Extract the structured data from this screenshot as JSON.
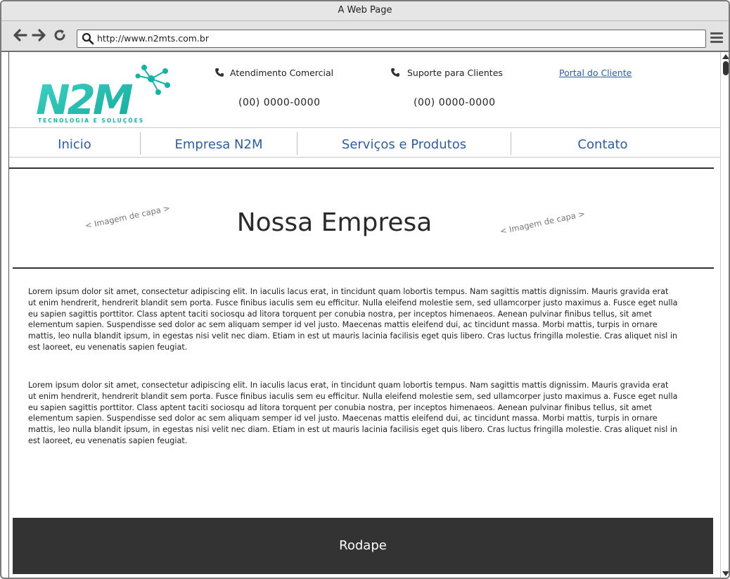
{
  "window": {
    "title": "A Web Page"
  },
  "browser": {
    "url": "http://www.n2mts.com.br"
  },
  "header": {
    "logo_alt": "N2M Tecnologia e Soluções",
    "commercial_label": "Atendimento Comercial",
    "commercial_phone": "(00) 0000-0000",
    "support_label": "Suporte para Clientes",
    "support_phone": "(00) 0000-0000",
    "portal_link": "Portal do Cliente"
  },
  "nav": {
    "items": [
      {
        "label": "Inicio"
      },
      {
        "label": "Empresa N2M"
      },
      {
        "label": "Serviços e Produtos"
      },
      {
        "label": "Contato"
      }
    ]
  },
  "hero": {
    "title": "Nossa Empresa",
    "cover_hint_left": "< Imagem de capa >",
    "cover_hint_right": "< Imagem de capa >"
  },
  "body": {
    "paragraphs": [
      "Lorem ipsum dolor sit amet, consectetur adipiscing elit. In iaculis lacus erat, in tincidunt quam lobortis tempus. Nam sagittis mattis dignissim. Mauris gravida erat ut enim hendrerit, hendrerit blandit sem porta. Fusce finibus iaculis sem eu efficitur. Nulla eleifend molestie sem, sed ullamcorper justo maximus a. Fusce eget nulla eu sapien sagittis porttitor. Class aptent taciti sociosqu ad litora torquent per conubia nostra, per inceptos himenaeos. Aenean pulvinar finibus tellus, sit amet elementum sapien. Suspendisse sed dolor ac sem aliquam semper id vel justo. Maecenas mattis eleifend dui, ac tincidunt massa. Morbi mattis, turpis in ornare mattis, leo nulla blandit ipsum, in egestas nisi velit nec diam. Etiam in est ut mauris lacinia facilisis eget quis libero. Cras luctus fringilla molestie. Cras aliquet nisl in est laoreet, eu venenatis sapien feugiat.",
      "Lorem ipsum dolor sit amet, consectetur adipiscing elit. In iaculis lacus erat, in tincidunt quam lobortis tempus. Nam sagittis mattis dignissim. Mauris gravida erat ut enim hendrerit, hendrerit blandit sem porta. Fusce finibus iaculis sem eu efficitur. Nulla eleifend molestie sem, sed ullamcorper justo maximus a. Fusce eget nulla eu sapien sagittis porttitor. Class aptent taciti sociosqu ad litora torquent per conubia nostra, per inceptos himenaeos. Aenean pulvinar finibus tellus, sit amet elementum sapien. Suspendisse sed dolor ac sem aliquam semper id vel justo. Maecenas mattis eleifend dui, ac tincidunt massa. Morbi mattis, turpis in ornare mattis, leo nulla blandit ipsum, in egestas nisi velit nec diam. Etiam in est ut mauris lacinia facilisis eget quis libero. Cras luctus fringilla molestie. Cras aliquet nisl in est laoreet, eu venenatis sapien feugiat."
    ]
  },
  "footer": {
    "label": "Rodape"
  },
  "icons": {
    "back": "back-arrow-icon",
    "forward": "forward-arrow-icon",
    "reload": "reload-icon",
    "search": "search-icon",
    "menu": "hamburger-menu-icon",
    "phone": "phone-icon"
  },
  "colors": {
    "link": "#2f5e9b",
    "footer_bg": "#333333",
    "logo_gradient_start": "#2ec4b6",
    "logo_gradient_end": "#16b7a7"
  }
}
